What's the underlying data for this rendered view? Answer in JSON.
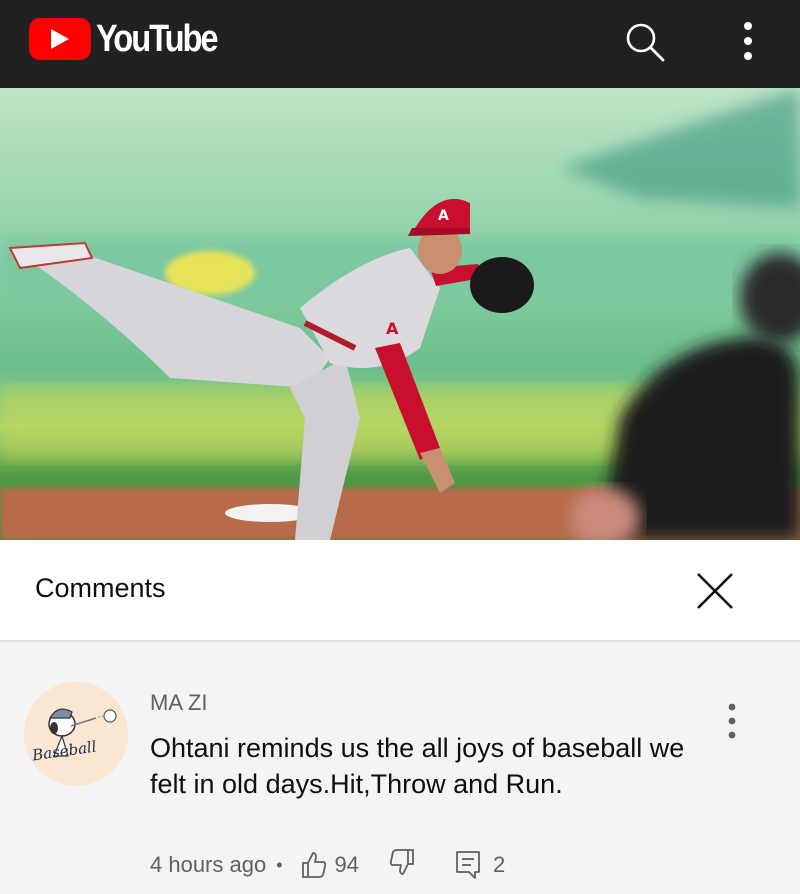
{
  "app": {
    "logo_text": "YouTube",
    "brand_color": "#ff0000",
    "icons": [
      "search-icon",
      "more-vert-icon"
    ]
  },
  "comments_panel": {
    "title": "Comments",
    "close_icon": "close-icon"
  },
  "comments": [
    {
      "author": "MA ZI",
      "avatar_text": "Baseball",
      "text": "Ohtani reminds us the all joys of baseball we felt in old days.Hit,Throw and Run.",
      "time": "4 hours ago",
      "separator": "•",
      "likes": "94",
      "replies": "2"
    }
  ]
}
